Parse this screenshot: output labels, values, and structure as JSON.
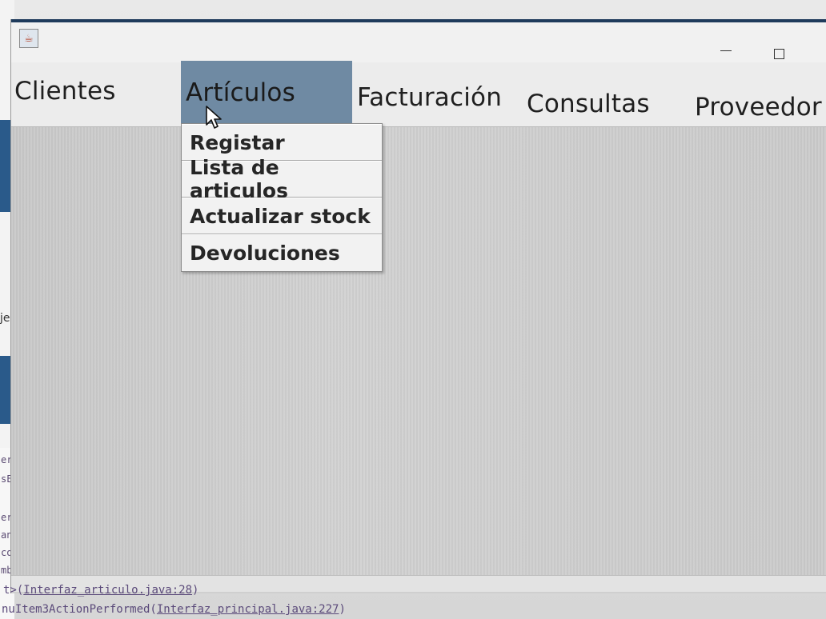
{
  "window": {
    "icon": "java-cup-icon",
    "controls": [
      "minimize-icon",
      "maximize-icon"
    ]
  },
  "menubar": {
    "items": [
      {
        "label": "Clientes"
      },
      {
        "label": "Artículos"
      },
      {
        "label": "Facturación"
      },
      {
        "label": "Consultas"
      },
      {
        "label": "Proveedor"
      }
    ],
    "active_color": "#6f8aa3"
  },
  "dropdown": {
    "items": [
      {
        "label": "Registar"
      },
      {
        "label": "Lista de articulos"
      },
      {
        "label": "Actualizar stock"
      },
      {
        "label": "Devoluciones"
      }
    ]
  },
  "background_ide": {
    "side_text": "je",
    "fragments": [
      "er",
      "sE",
      "er",
      "an",
      "co",
      "mb"
    ],
    "console": [
      {
        "prefix": "t>(",
        "link": "Interfaz_articulo.java:28",
        "suffix": ")"
      },
      {
        "prefix": "nuItem3ActionPerformed(",
        "link": "Interfaz_principal.java:227",
        "suffix": ")"
      }
    ]
  }
}
